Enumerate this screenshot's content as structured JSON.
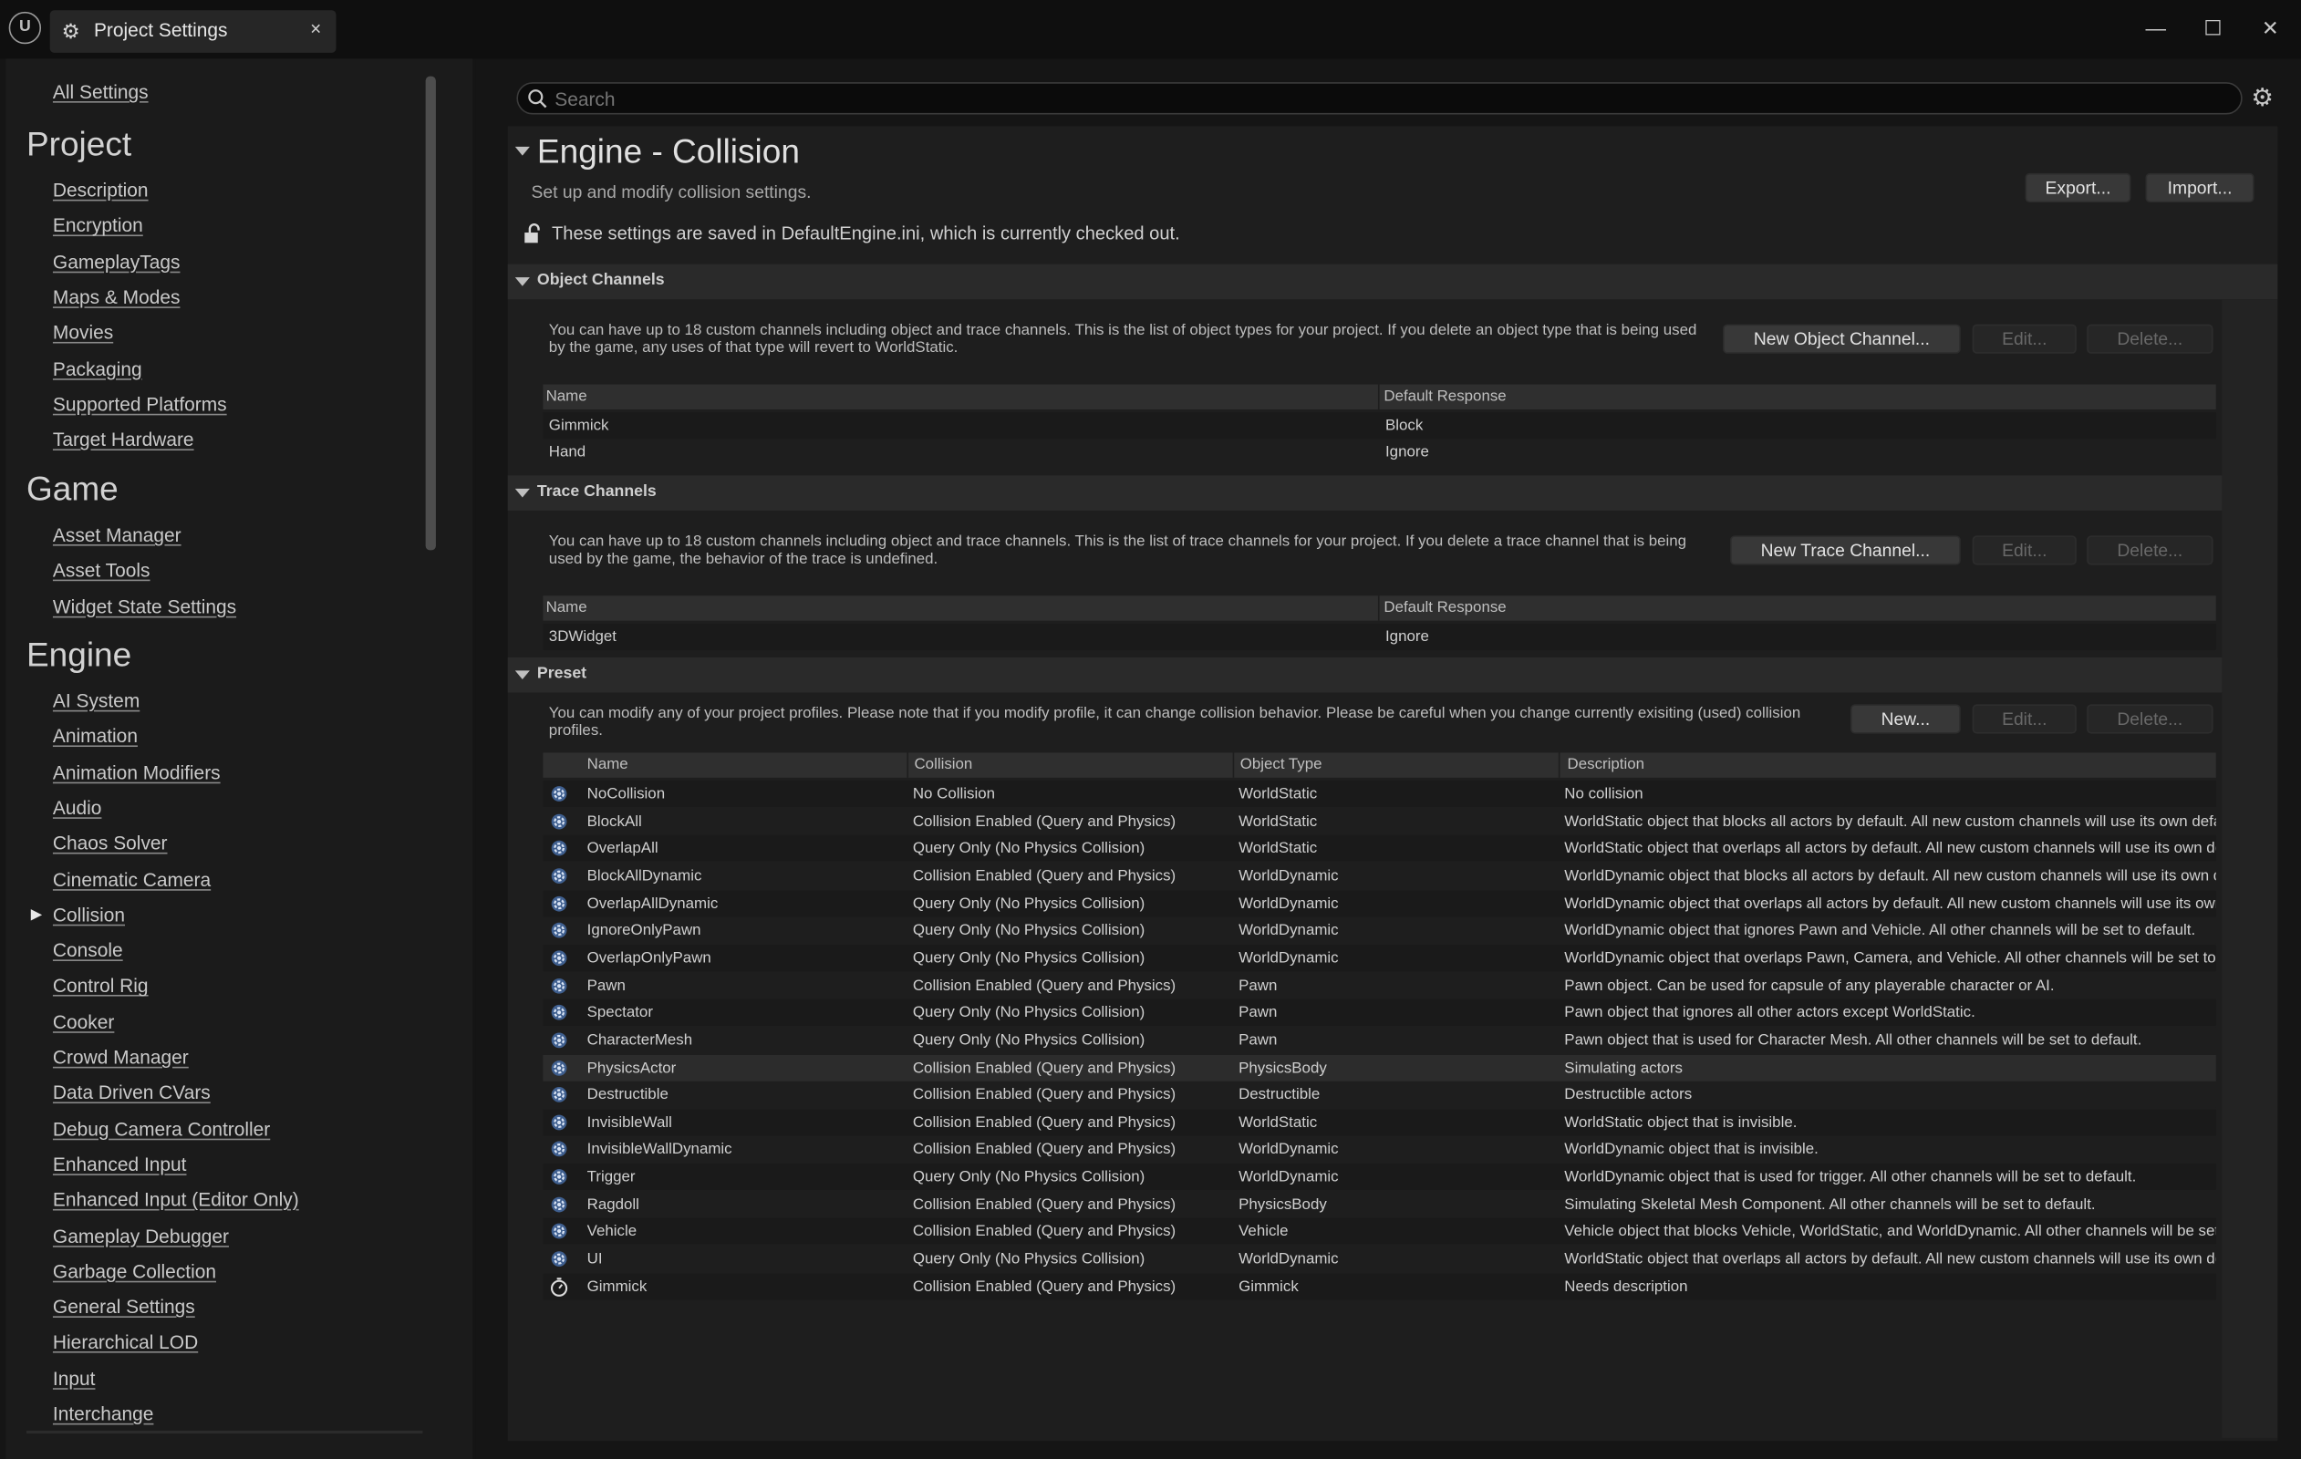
{
  "window": {
    "tab_title": "Project Settings",
    "tab_close": "×",
    "logo": "U",
    "minimize": "—",
    "maximize": "☐",
    "close": "✕"
  },
  "sidebar": {
    "all_settings": "All Settings",
    "sections": [
      {
        "title": "Project",
        "items": [
          "Description",
          "Encryption",
          "GameplayTags",
          "Maps & Modes",
          "Movies",
          "Packaging",
          "Supported Platforms",
          "Target Hardware"
        ]
      },
      {
        "title": "Game",
        "items": [
          "Asset Manager",
          "Asset Tools",
          "Widget State Settings"
        ]
      },
      {
        "title": "Engine",
        "items": [
          "AI System",
          "Animation",
          "Animation Modifiers",
          "Audio",
          "Chaos Solver",
          "Cinematic Camera",
          "Collision",
          "Console",
          "Control Rig",
          "Cooker",
          "Crowd Manager",
          "Data Driven CVars",
          "Debug Camera Controller",
          "Enhanced Input",
          "Enhanced Input (Editor Only)",
          "Gameplay Debugger",
          "Garbage Collection",
          "General Settings",
          "Hierarchical LOD",
          "Input",
          "Interchange"
        ]
      }
    ],
    "selected": "Collision"
  },
  "search": {
    "placeholder": "Search",
    "value": ""
  },
  "page": {
    "title": "Engine - Collision",
    "subtitle": "Set up and modify collision settings.",
    "export_label": "Export...",
    "import_label": "Import...",
    "notice": "These settings are saved in DefaultEngine.ini, which is currently checked out."
  },
  "object_channels": {
    "header": "Object Channels",
    "info": "You can have up to 18 custom channels including object and trace channels. This is the list of object types for your project. If you delete an object type that is being used by the game, any uses of that type will revert to WorldStatic.",
    "new_label": "New Object Channel...",
    "edit_label": "Edit...",
    "delete_label": "Delete...",
    "columns": [
      "Name",
      "Default Response"
    ],
    "rows": [
      [
        "Gimmick",
        "Block"
      ],
      [
        "Hand",
        "Ignore"
      ]
    ]
  },
  "trace_channels": {
    "header": "Trace Channels",
    "info": "You can have up to 18 custom channels including object and trace channels. This is the list of trace channels for your project. If you delete a trace channel that is being used by the game, the behavior of the trace is undefined.",
    "new_label": "New Trace Channel...",
    "edit_label": "Edit...",
    "delete_label": "Delete...",
    "columns": [
      "Name",
      "Default Response"
    ],
    "rows": [
      [
        "3DWidget",
        "Ignore"
      ]
    ]
  },
  "preset": {
    "header": "Preset",
    "info": "You can modify any of your project profiles. Please note that if you modify profile, it can change collision behavior. Please be careful when you change currently exisiting (used) collision profiles.",
    "new_label": "New...",
    "edit_label": "Edit...",
    "delete_label": "Delete...",
    "columns": [
      "Name",
      "Collision",
      "Object Type",
      "Description"
    ],
    "selected_row": 10,
    "rows": [
      {
        "icon": "gear",
        "name": "NoCollision",
        "collision": "No Collision",
        "type": "WorldStatic",
        "desc": "No collision"
      },
      {
        "icon": "gear",
        "name": "BlockAll",
        "collision": "Collision Enabled (Query and Physics)",
        "type": "WorldStatic",
        "desc": "WorldStatic object that blocks all actors by default. All new custom channels will use its own default r"
      },
      {
        "icon": "gear",
        "name": "OverlapAll",
        "collision": "Query Only (No Physics Collision)",
        "type": "WorldStatic",
        "desc": "WorldStatic object that overlaps all actors by default. All new custom channels will use its own defaul"
      },
      {
        "icon": "gear",
        "name": "BlockAllDynamic",
        "collision": "Collision Enabled (Query and Physics)",
        "type": "WorldDynamic",
        "desc": "WorldDynamic object that blocks all actors by default. All new custom channels will use its own defau"
      },
      {
        "icon": "gear",
        "name": "OverlapAllDynamic",
        "collision": "Query Only (No Physics Collision)",
        "type": "WorldDynamic",
        "desc": "WorldDynamic object that overlaps all actors by default. All new custom channels will use its own def"
      },
      {
        "icon": "gear",
        "name": "IgnoreOnlyPawn",
        "collision": "Query Only (No Physics Collision)",
        "type": "WorldDynamic",
        "desc": "WorldDynamic object that ignores Pawn and Vehicle. All other channels will be set to default."
      },
      {
        "icon": "gear",
        "name": "OverlapOnlyPawn",
        "collision": "Query Only (No Physics Collision)",
        "type": "WorldDynamic",
        "desc": "WorldDynamic object that overlaps Pawn, Camera, and Vehicle. All other channels will be set to defau"
      },
      {
        "icon": "gear",
        "name": "Pawn",
        "collision": "Collision Enabled (Query and Physics)",
        "type": "Pawn",
        "desc": "Pawn object. Can be used for capsule of any playerable character or AI."
      },
      {
        "icon": "gear",
        "name": "Spectator",
        "collision": "Query Only (No Physics Collision)",
        "type": "Pawn",
        "desc": "Pawn object that ignores all other actors except WorldStatic."
      },
      {
        "icon": "gear",
        "name": "CharacterMesh",
        "collision": "Query Only (No Physics Collision)",
        "type": "Pawn",
        "desc": "Pawn object that is used for Character Mesh. All other channels will be set to default."
      },
      {
        "icon": "gear",
        "name": "PhysicsActor",
        "collision": "Collision Enabled (Query and Physics)",
        "type": "PhysicsBody",
        "desc": "Simulating actors"
      },
      {
        "icon": "gear",
        "name": "Destructible",
        "collision": "Collision Enabled (Query and Physics)",
        "type": "Destructible",
        "desc": "Destructible actors"
      },
      {
        "icon": "gear",
        "name": "InvisibleWall",
        "collision": "Collision Enabled (Query and Physics)",
        "type": "WorldStatic",
        "desc": "WorldStatic object that is invisible."
      },
      {
        "icon": "gear",
        "name": "InvisibleWallDynamic",
        "collision": "Collision Enabled (Query and Physics)",
        "type": "WorldDynamic",
        "desc": "WorldDynamic object that is invisible."
      },
      {
        "icon": "gear",
        "name": "Trigger",
        "collision": "Query Only (No Physics Collision)",
        "type": "WorldDynamic",
        "desc": "WorldDynamic object that is used for trigger. All other channels will be set to default."
      },
      {
        "icon": "gear",
        "name": "Ragdoll",
        "collision": "Collision Enabled (Query and Physics)",
        "type": "PhysicsBody",
        "desc": "Simulating Skeletal Mesh Component. All other channels will be set to default."
      },
      {
        "icon": "gear",
        "name": "Vehicle",
        "collision": "Collision Enabled (Query and Physics)",
        "type": "Vehicle",
        "desc": "Vehicle object that blocks Vehicle, WorldStatic, and WorldDynamic. All other channels will be set to de"
      },
      {
        "icon": "gear",
        "name": "UI",
        "collision": "Query Only (No Physics Collision)",
        "type": "WorldDynamic",
        "desc": "WorldStatic object that overlaps all actors by default. All new custom channels will use its own defaul"
      },
      {
        "icon": "stopwatch",
        "name": "Gimmick",
        "collision": "Collision Enabled (Query and Physics)",
        "type": "Gimmick",
        "desc": "Needs description"
      }
    ]
  },
  "colors": {
    "background": "#151515",
    "panel": "#1e1e1e",
    "header": "#2a2a2a",
    "text": "#c0c0c0"
  }
}
